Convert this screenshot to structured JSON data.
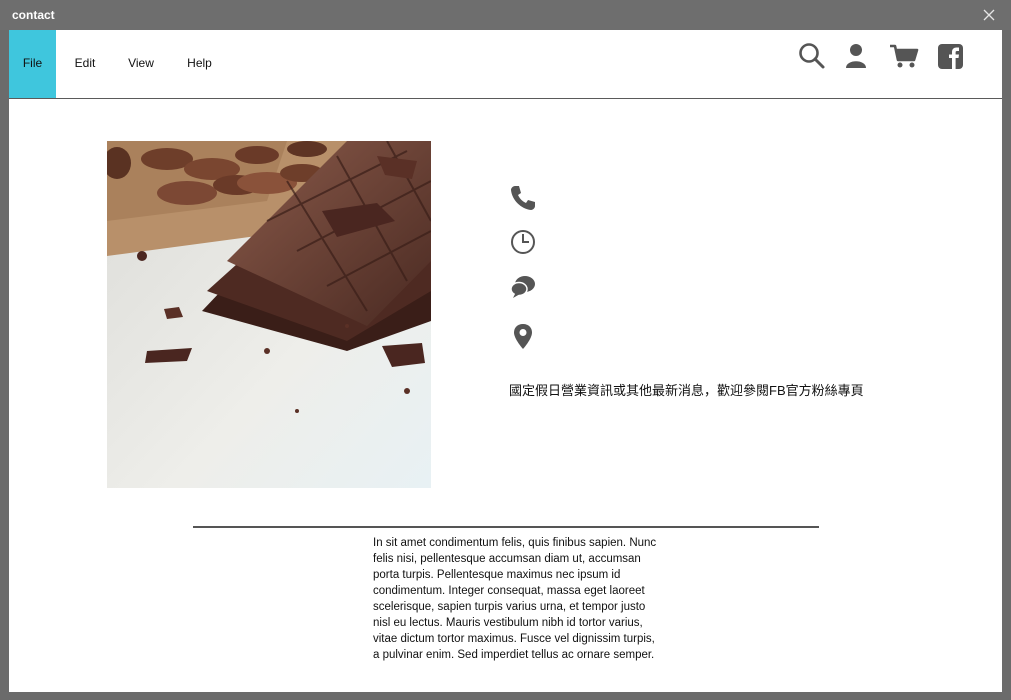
{
  "window": {
    "title": "contact"
  },
  "menu": {
    "items": [
      "File",
      "Edit",
      "View",
      "Help"
    ],
    "active": "File"
  },
  "colors": {
    "accent": "#3fc6dd",
    "icon": "#555555",
    "frame": "#6e6e6e"
  },
  "toolbar_icons": [
    "search-icon",
    "user-icon",
    "cart-icon",
    "facebook-icon"
  ],
  "contact_icons": [
    "phone-icon",
    "clock-icon",
    "chat-icon",
    "location-pin-icon"
  ],
  "notice": "國定假日營業資訊或其他最新消息，歡迎參閱FB官方粉絲專頁",
  "paragraph": "In sit amet condimentum felis, quis finibus sapien. Nunc felis nisi, pellentesque accumsan diam ut, accumsan porta turpis. Pellentesque maximus nec ipsum id condimentum. Integer consequat, massa eget laoreet scelerisque, sapien turpis varius urna, et tempor justo nisl eu lectus. Mauris vestibulum nibh id tortor varius, vitae dictum tortor maximus. Fusce vel dignissim turpis, a pulvinar enim. Sed imperdiet tellus ac ornare semper."
}
